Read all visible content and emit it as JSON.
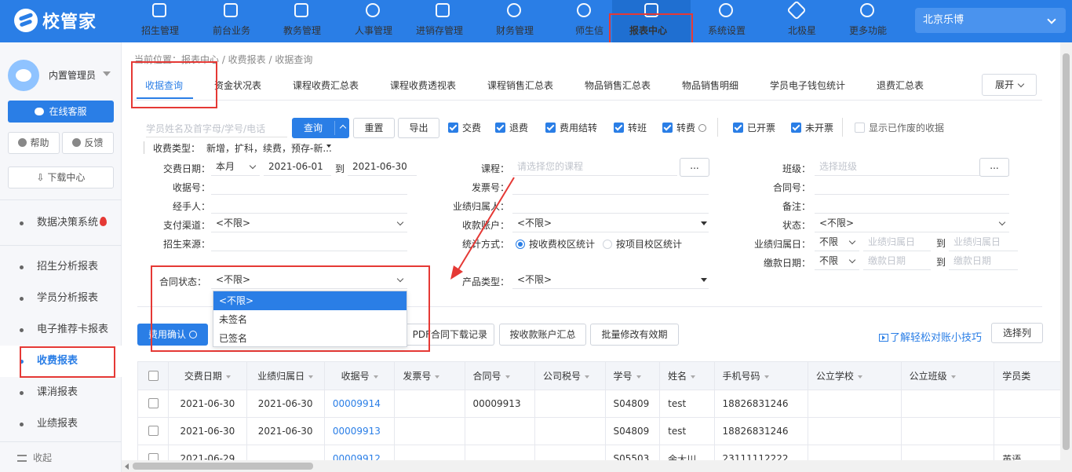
{
  "brand": {
    "name": "校管家"
  },
  "nav": [
    {
      "label": "招生管理",
      "icon": "user-plus-icon"
    },
    {
      "label": "前台业务",
      "icon": "monitor-icon"
    },
    {
      "label": "教务管理",
      "icon": "book-icon"
    },
    {
      "label": "人事管理",
      "icon": "person-icon"
    },
    {
      "label": "进销存管理",
      "icon": "inventory-icon"
    },
    {
      "label": "财务管理",
      "icon": "yen-icon"
    },
    {
      "label": "师生信",
      "icon": "chat-icon"
    },
    {
      "label": "报表中心",
      "icon": "report-icon"
    },
    {
      "label": "系统设置",
      "icon": "gear-icon"
    },
    {
      "label": "北极星",
      "icon": "star-icon"
    },
    {
      "label": "更多功能",
      "icon": "more-icon"
    }
  ],
  "campus": "北京乐博",
  "sidebar": {
    "user": "内置管理员",
    "service": "在线客服",
    "help": "帮助",
    "feedback": "反馈",
    "download": "下载中心",
    "items": [
      "数据决策系统",
      "招生分析报表",
      "学员分析报表",
      "电子推荐卡报表",
      "收费报表",
      "课消报表",
      "业绩报表"
    ],
    "collapse": "收起"
  },
  "breadcrumb": "当前位置：报表中心 / 收费报表 / 收据查询",
  "tabs": [
    "收据查询",
    "资金状况表",
    "课程收费汇总表",
    "课程收费透视表",
    "课程销售汇总表",
    "物品销售汇总表",
    "物品销售明细",
    "学员电子钱包统计",
    "退费汇总表"
  ],
  "expand": "展开",
  "search": {
    "placeholder": "学员姓名及首字母/学号/电话",
    "query": "查询",
    "reset": "重置",
    "export": "导出"
  },
  "checks": [
    "交费",
    "退费",
    "费用结转",
    "转班",
    "转费",
    "已开票",
    "未开票",
    "显示已作废的收据"
  ],
  "filters": {
    "fee_type_label": "收费类型：",
    "fee_type_value": "新增，扩科，续费，预存-新...",
    "date_label": "交费日期：",
    "date_scope": "本月",
    "date_from": "2021-06-01",
    "date_to_word": "到",
    "date_to": "2021-06-30",
    "receipt_no": "收据号：",
    "handler": "经手人：",
    "pay_channel": "支付渠道：",
    "pay_channel_value": "<不限>",
    "source": "招生来源：",
    "contract_status": "合同状态：",
    "contract_status_value": "<不限>",
    "course": "课程：",
    "course_ph": "请选择您的课程",
    "invoice_no": "发票号：",
    "perf_owner": "业绩归属人：",
    "account": "收款账户：",
    "account_value": "<不限>",
    "stat_mode": "统计方式：",
    "stat_opt1": "按收费校区统计",
    "stat_opt2": "按项目校区统计",
    "product_type": "产品类型：",
    "product_type_value": "<不限>",
    "class": "班级：",
    "class_ph": "选择班级",
    "contract_no": "合同号：",
    "remark": "备注：",
    "status": "状态：",
    "status_value": "<不限>",
    "perf_date": "业绩归属日：",
    "perf_scope": "不限",
    "perf_from_ph": "业绩归属日",
    "perf_to_ph": "业绩归属日",
    "pay_due": "缴款日期：",
    "pay_due_scope": "不限",
    "pay_due_from_ph": "缴款日期",
    "pay_due_to_ph": "缴款日期",
    "dots": "..."
  },
  "dropdown_options": [
    "<不限>",
    "未签名",
    "已签名"
  ],
  "toolbar": {
    "confirm": "费用确认",
    "pdf": "PDF合同下载记录",
    "acct_sum": "按收款账户汇总",
    "batch": "批量修改有效期",
    "tip": "了解轻松对账小技巧",
    "cols": "选择列"
  },
  "table": {
    "headers": [
      "交费日期",
      "业绩归属日",
      "收据号",
      "发票号",
      "合同号",
      "公司税号",
      "学号",
      "姓名",
      "手机号码",
      "公立学校",
      "公立班级",
      "学员类"
    ],
    "rows": [
      [
        "2021-06-30",
        "2021-06-30",
        "00009914",
        "",
        "00009913",
        "",
        "S04809",
        "test",
        "18826831246",
        "",
        "",
        ""
      ],
      [
        "2021-06-30",
        "2021-06-30",
        "00009913",
        "",
        "",
        "",
        "S04809",
        "test",
        "18826831246",
        "",
        "",
        ""
      ],
      [
        "2021-06-29",
        "",
        "00009912",
        "",
        "",
        "",
        "S05503",
        "余大川",
        "23111112222",
        "",
        "",
        "英语"
      ]
    ]
  }
}
